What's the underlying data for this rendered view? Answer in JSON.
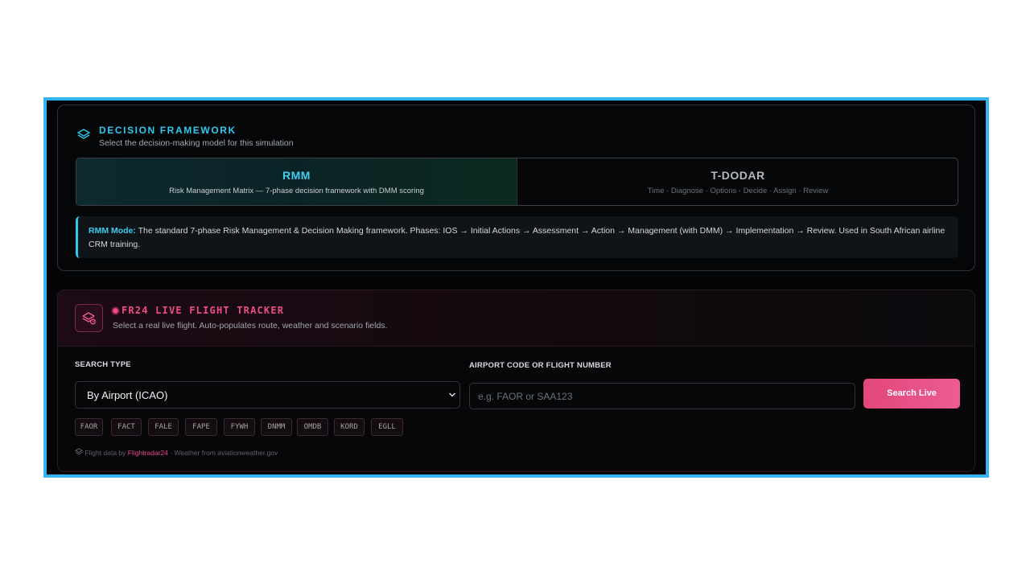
{
  "framework": {
    "title": "DECISION FRAMEWORK",
    "subtitle": "Select the decision-making model for this simulation",
    "options": [
      {
        "name": "RMM",
        "desc": "Risk Management Matrix — 7-phase decision framework with DMM scoring",
        "selected": true
      },
      {
        "name": "T-DODAR",
        "desc": "Time · Diagnose · Options · Decide · Assign · Review",
        "selected": false
      }
    ],
    "info_label": "RMM Mode:",
    "info_text": " The standard 7-phase Risk Management & Decision Making framework. Phases: IOS → Initial Actions → Assessment → Action → Management (with DMM) → Implementation → Review. Used in South African airline CRM training."
  },
  "tracker": {
    "title": "FR24 LIVE FLIGHT TRACKER",
    "subtitle": "Select a real live flight. Auto-populates route, weather and scenario fields.",
    "search_type_label": "SEARCH TYPE",
    "search_type_value": "By Airport (ICAO)",
    "query_label": "AIRPORT CODE OR FLIGHT NUMBER",
    "query_placeholder": "e.g. FAOR or SAA123",
    "search_button": "Search Live",
    "quick_codes": [
      "FAOR",
      "FACT",
      "FALE",
      "FAPE",
      "FYWH",
      "DNMM",
      "OMDB",
      "KORD",
      "EGLL"
    ],
    "footer_prefix": "Flight data by",
    "footer_link": "Flightradar24",
    "footer_suffix": "· Weather from aviationweather.gov"
  },
  "colors": {
    "frame_border": "#35b3f2",
    "cyan_accent": "#2fc8ee",
    "pink_accent": "#e2467c"
  }
}
